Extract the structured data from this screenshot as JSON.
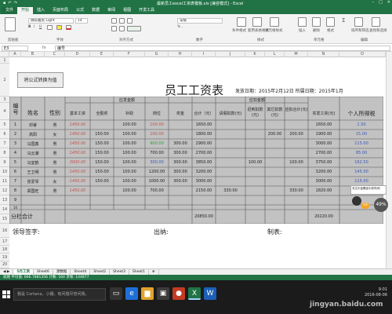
{
  "window": {
    "title": "最新员工excel工资表模板.xls [兼容模式] - Excel"
  },
  "ribbon_tabs": [
    "文件",
    "开始",
    "插入",
    "页面布局",
    "公式",
    "数据",
    "审阅",
    "视图",
    "开发工具"
  ],
  "ribbon": {
    "font_name": "微软雅黑 Light",
    "font_size": "14",
    "number_format": "常规",
    "groups": [
      "剪贴板",
      "字体",
      "对齐方式",
      "数字",
      "样式",
      "单元格",
      "编辑"
    ],
    "buttons": [
      "条件格式",
      "套用表格格式",
      "单元格样式",
      "插入",
      "删除",
      "格式",
      "排序和筛选",
      "查找和选择"
    ]
  },
  "formula_bar": {
    "name_box": "E3",
    "fx": "fx",
    "value": "编号"
  },
  "columns": [
    "A",
    "B",
    "C",
    "D",
    "E",
    "F",
    "G",
    "H",
    "I",
    "J",
    "K",
    "L",
    "M",
    "N",
    "O"
  ],
  "rows": [
    "1",
    "2",
    "3",
    "4",
    "5",
    "6",
    "7",
    "8",
    "9",
    "10",
    "11",
    "12",
    "13",
    "14",
    "15",
    "16",
    "17",
    "18",
    "19",
    "20"
  ],
  "sheet": {
    "convert_button": "将公式转换为值",
    "title": "员工工资表",
    "issue_date": "发放日期：2015年2月12日  所属日期：2015年1月",
    "group_payable": "应发金额",
    "group_deduct": "应扣金额",
    "headers": [
      "编号",
      "姓名",
      "性别",
      "基本工资",
      "全勤奖",
      "补助",
      "岗位",
      "奖金",
      "合计（元）",
      "请假扣款(元)",
      "迟到扣款(元)",
      "其它扣款(元)",
      "应扣合计(元)",
      "实发工资(元)",
      "个人所得税"
    ],
    "employees": [
      {
        "no": "1",
        "name": "邓睿",
        "gender": "男",
        "base": "1450.00",
        "attend": "",
        "subsidy": "100.00",
        "post": "100.00",
        "bonus": "",
        "total": "1650.00",
        "leave": "",
        "late": "",
        "other": "",
        "deduct_total": "",
        "net": "1650.00",
        "tax": "2.50"
      },
      {
        "no": "2",
        "name": "高阳",
        "gender": "女",
        "base": "1450.00",
        "attend": "150.00",
        "subsidy": "100.00",
        "post": "100.00",
        "bonus": "",
        "total": "1800.00",
        "leave": "",
        "late": "",
        "other": "200.00",
        "deduct_total": "200.00",
        "net": "1900.00",
        "tax": "15.00"
      },
      {
        "no": "3",
        "name": "马国鑫",
        "gender": "男",
        "base": "1450.00",
        "attend": "150.00",
        "subsidy": "100.00",
        "post": "900.00",
        "bonus": "300.00",
        "total": "2900.00",
        "leave": "",
        "late": "",
        "other": "",
        "deduct_total": "",
        "net": "3000.00",
        "tax": "115.00"
      },
      {
        "no": "4",
        "name": "马云潮",
        "gender": "男",
        "base": "1450.00",
        "attend": "150.00",
        "subsidy": "100.00",
        "post": "700.00",
        "bonus": "300.00",
        "total": "2700.00",
        "leave": "",
        "late": "",
        "other": "",
        "deduct_total": "",
        "net": "2700.00",
        "tax": "85.00"
      },
      {
        "no": "5",
        "name": "马宜鹤",
        "gender": "男",
        "base": "3000.00",
        "attend": "150.00",
        "subsidy": "100.00",
        "post": "300.00",
        "bonus": "300.00",
        "total": "3850.00",
        "leave": "",
        "late": "100.00",
        "other": "",
        "deduct_total": "100.00",
        "net": "3750.00",
        "tax": "162.50"
      },
      {
        "no": "6",
        "name": "王卫明",
        "gender": "男",
        "base": "1450.00",
        "attend": "150.00",
        "subsidy": "100.00",
        "post": "1200.00",
        "bonus": "300.00",
        "total": "3200.00",
        "leave": "",
        "late": "",
        "other": "",
        "deduct_total": "",
        "net": "3200.00",
        "tax": "145.00"
      },
      {
        "no": "7",
        "name": "张爱琴",
        "gender": "女",
        "base": "1450.00",
        "attend": "150.00",
        "subsidy": "100.00",
        "post": "1000.00",
        "bonus": "300.00",
        "total": "3000.00",
        "leave": "",
        "late": "",
        "other": "",
        "deduct_total": "",
        "net": "3000.00",
        "tax": "115.00"
      },
      {
        "no": "8",
        "name": "郑国旺",
        "gender": "男",
        "base": "1450.00",
        "attend": "",
        "subsidy": "100.00",
        "post": "700.00",
        "bonus": "",
        "total": "2150.00",
        "leave": "330.00",
        "late": "",
        "other": "",
        "deduct_total": "330.00",
        "net": "1820.00",
        "tax": "12.00"
      }
    ],
    "blank_rows": [
      "9",
      "10",
      "11"
    ],
    "subtotal_label": "分栏合计",
    "subtotal_total": "20850.00",
    "subtotal_net": "20220.00",
    "sign_leader": "领导签字:",
    "sign_cashier": "出纳:",
    "sign_maker": "制表:"
  },
  "sheet_tabs": [
    "5月工资",
    "Sheet6",
    "源数据",
    "Sheet4",
    "Sheet2",
    "Sheet3",
    "Sheet1"
  ],
  "status": {
    "text": "就绪  平均值: 666.7881356  计数: 160  求和: 104877"
  },
  "taskbar": {
    "search_placeholder": "我是 Cortana，小娜。有问题尽管问我。",
    "time": "9:01",
    "date": "2016-08-06"
  },
  "overlay": {
    "notice": "关注中金腾延中老时间！",
    "score": "16",
    "percent": "49"
  },
  "watermark": "jingyan.baidu.com"
}
